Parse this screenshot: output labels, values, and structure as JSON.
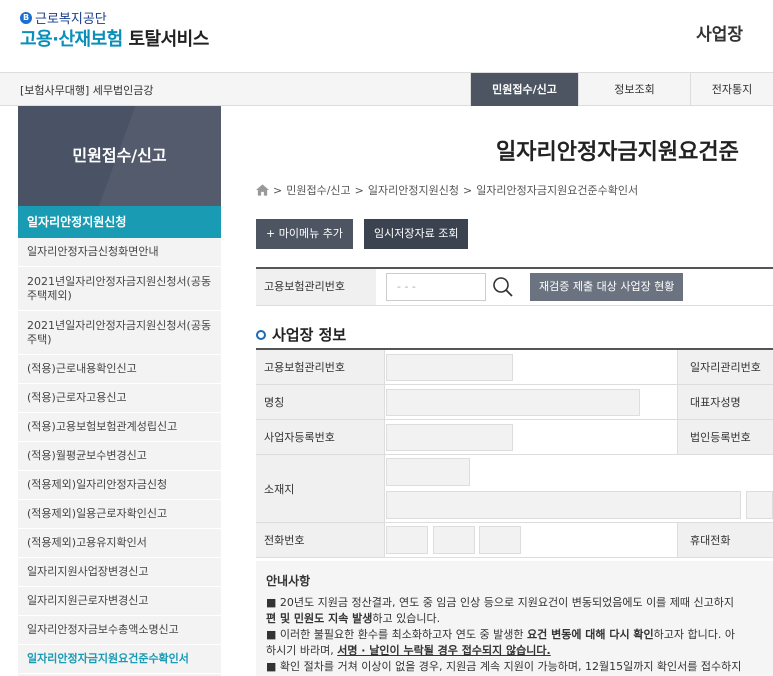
{
  "header": {
    "org_small": "근로복지공단",
    "logo_part1": "고용·산재보험",
    "logo_part2": " 토탈서비스",
    "right_title": "사업장"
  },
  "nav": {
    "office_label": "[보험사무대행] 세무법인금강",
    "tabs": [
      {
        "label": "민원접수/신고",
        "active": true
      },
      {
        "label": "정보조회",
        "active": false
      },
      {
        "label": "전자통지",
        "active": false
      }
    ]
  },
  "sidebar": {
    "header": "민원접수/신고",
    "section": "일자리안정지원신청",
    "items": [
      "일자리안정자금신청화면안내",
      "2021년일자리안정자금지원신청서(공동주택제외)",
      "2021년일자리안정자금지원신청서(공동주택)",
      "(적용)근로내용확인신고",
      "(적용)근로자고용신고",
      "(적용)고용보험보험관계성립신고",
      "(적용)월평균보수변경신고",
      "(적용제외)일자리안정자금신청",
      "(적용제외)일용근로자확인신고",
      "(적용제외)고용유지확인서",
      "일자리지원사업장변경신고",
      "일자리지원근로자변경신고",
      "일자리안정자금보수총액소명신고",
      "일자리안정자금지원요건준수확인서"
    ]
  },
  "main": {
    "page_title": "일자리안정자금지원요건준",
    "breadcrumb": [
      "민원접수/신고",
      "일자리안정지원신청",
      "일자리안정자금지원요건준수확인서"
    ],
    "btn_mymenu": "+ 마이메뉴 추가",
    "btn_temp": "임시저장자료 조회",
    "search_label": "고용보험관리번호",
    "search_placeholder": "- - -",
    "btn_recheck": "재검증 제출 대상 사업장 현황",
    "section_title": "사업장 정보",
    "labels": {
      "insurance_no": "고용보험관리번호",
      "job_no": "일자리관리번호",
      "name": "명칭",
      "ceo": "대표자성명",
      "biz_no": "사업자등록번호",
      "corp_no": "법인등록번호",
      "address": "소재지",
      "phone": "전화번호",
      "mobile": "휴대전화"
    },
    "notice": {
      "title": "안내사항",
      "line1": "■ 20년도 지원금 정산결과, 연도 중 임금 인상 등으로 지원요건이 변동되었음에도 이를 제때 신고하지",
      "line2_bold": "편 및 민원도 지속 발생",
      "line2_rest": "하고 있습니다.",
      "line3_a": "■ 이러한 불필요한 환수를 최소화하고자 연도 중 발생한 ",
      "line3_bold": "요건 변동에 대해 다시 확인",
      "line3_b": "하고자 합니다. 아",
      "line4_a": "하시기 바라며, ",
      "line4_u": "서명 · 날인이 누락될 경우 접수되지 않습니다.",
      "line5": "■ 확인 절차를 거쳐 이상이 없을 경우, 지원금 계속 지원이 가능하며, 12월15일까지 확인서를 접수하지"
    }
  }
}
